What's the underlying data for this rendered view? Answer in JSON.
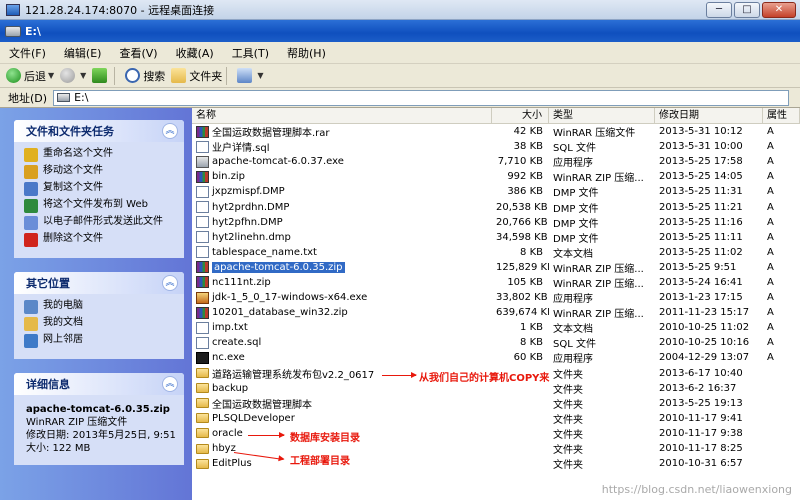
{
  "rdp": {
    "title": "121.28.24.174:8070 - 远程桌面连接",
    "minimize": "─",
    "maximize": "□",
    "close": "✕"
  },
  "explorer": {
    "title": "E:\\"
  },
  "menu": [
    "文件(F)",
    "编辑(E)",
    "查看(V)",
    "收藏(A)",
    "工具(T)",
    "帮助(H)"
  ],
  "toolbar": {
    "back": "后退",
    "search": "搜索",
    "folders": "文件夹"
  },
  "address": {
    "label": "地址(D)",
    "value": "E:\\"
  },
  "tasks_panel": {
    "title": "文件和文件夹任务",
    "items": [
      {
        "label": "重命名这个文件",
        "icon": "rename-icon",
        "color": "#e0b020"
      },
      {
        "label": "移动这个文件",
        "icon": "move-icon",
        "color": "#d9a020"
      },
      {
        "label": "复制这个文件",
        "icon": "copy-icon",
        "color": "#4a78c8"
      },
      {
        "label": "将这个文件发布到 Web",
        "icon": "web-publish-icon",
        "color": "#2e8a3e"
      },
      {
        "label": "以电子邮件形式发送此文件",
        "icon": "email-icon",
        "color": "#6a8ed8"
      },
      {
        "label": "删除这个文件",
        "icon": "delete-icon",
        "color": "#d0241c"
      }
    ]
  },
  "places_panel": {
    "title": "其它位置",
    "items": [
      {
        "label": "我的电脑",
        "icon": "my-computer-icon",
        "color": "#5b88c8"
      },
      {
        "label": "我的文档",
        "icon": "my-documents-icon",
        "color": "#e5b94a"
      },
      {
        "label": "网上邻居",
        "icon": "network-icon",
        "color": "#3e7ac8"
      }
    ]
  },
  "details_panel": {
    "title": "详细信息",
    "filename": "apache-tomcat-6.0.35.zip",
    "type": "WinRAR ZIP 压缩文件",
    "modified": "修改日期: 2013年5月25日, 9:51",
    "size": "大小: 122 MB"
  },
  "columns": {
    "name": "名称",
    "size": "大小",
    "type": "类型",
    "date": "修改日期",
    "attr": "属性"
  },
  "files": [
    {
      "name": "全国运政数据管理脚本.rar",
      "size": "42 KB",
      "type": "WinRAR 压缩文件",
      "date": "2013-5-31 10:12",
      "attr": "A",
      "icon": "archive"
    },
    {
      "name": "业户详情.sql",
      "size": "38 KB",
      "type": "SQL 文件",
      "date": "2013-5-31 10:00",
      "attr": "A",
      "icon": "doc"
    },
    {
      "name": "apache-tomcat-6.0.37.exe",
      "size": "7,710 KB",
      "type": "应用程序",
      "date": "2013-5-25 17:58",
      "attr": "A",
      "icon": "exe"
    },
    {
      "name": "bin.zip",
      "size": "992 KB",
      "type": "WinRAR ZIP 压缩...",
      "date": "2013-5-25 14:05",
      "attr": "A",
      "icon": "archive"
    },
    {
      "name": "jxpzmispf.DMP",
      "size": "386 KB",
      "type": "DMP 文件",
      "date": "2013-5-25 11:31",
      "attr": "A",
      "icon": "doc"
    },
    {
      "name": "hyt2prdhn.DMP",
      "size": "20,538 KB",
      "type": "DMP 文件",
      "date": "2013-5-25 11:21",
      "attr": "A",
      "icon": "doc"
    },
    {
      "name": "hyt2pfhn.DMP",
      "size": "20,766 KB",
      "type": "DMP 文件",
      "date": "2013-5-25 11:16",
      "attr": "A",
      "icon": "doc"
    },
    {
      "name": "hyt2linehn.dmp",
      "size": "34,598 KB",
      "type": "DMP 文件",
      "date": "2013-5-25 11:11",
      "attr": "A",
      "icon": "doc"
    },
    {
      "name": "tablespace_name.txt",
      "size": "8 KB",
      "type": "文本文档",
      "date": "2013-5-25 11:02",
      "attr": "A",
      "icon": "doc"
    },
    {
      "name": "apache-tomcat-6.0.35.zip",
      "size": "125,829 KB",
      "type": "WinRAR ZIP 压缩...",
      "date": "2013-5-25 9:51",
      "attr": "A",
      "icon": "archive",
      "selected": true
    },
    {
      "name": "nc111nt.zip",
      "size": "105 KB",
      "type": "WinRAR ZIP 压缩...",
      "date": "2013-5-24 16:41",
      "attr": "A",
      "icon": "archive"
    },
    {
      "name": "jdk-1_5_0_17-windows-x64.exe",
      "size": "33,802 KB",
      "type": "应用程序",
      "date": "2013-1-23 17:15",
      "attr": "A",
      "icon": "java"
    },
    {
      "name": "10201_database_win32.zip",
      "size": "639,674 KB",
      "type": "WinRAR ZIP 压缩...",
      "date": "2011-11-23 15:17",
      "attr": "A",
      "icon": "archive"
    },
    {
      "name": "imp.txt",
      "size": "1 KB",
      "type": "文本文档",
      "date": "2010-10-25 11:02",
      "attr": "A",
      "icon": "doc"
    },
    {
      "name": "create.sql",
      "size": "8 KB",
      "type": "SQL 文件",
      "date": "2010-10-25 10:16",
      "attr": "A",
      "icon": "doc"
    },
    {
      "name": "nc.exe",
      "size": "60 KB",
      "type": "应用程序",
      "date": "2004-12-29 13:07",
      "attr": "A",
      "icon": "nc"
    },
    {
      "name": "道路运输管理系统发布包v2.2_0617",
      "size": "",
      "type": "文件夹",
      "date": "2013-6-17 10:40",
      "attr": "",
      "icon": "folder"
    },
    {
      "name": "backup",
      "size": "",
      "type": "文件夹",
      "date": "2013-6-2 16:37",
      "attr": "",
      "icon": "folder"
    },
    {
      "name": "全国运政数据管理脚本",
      "size": "",
      "type": "文件夹",
      "date": "2013-5-25 19:13",
      "attr": "",
      "icon": "folder"
    },
    {
      "name": "PLSQLDeveloper",
      "size": "",
      "type": "文件夹",
      "date": "2010-11-17 9:41",
      "attr": "",
      "icon": "folder"
    },
    {
      "name": "oracle",
      "size": "",
      "type": "文件夹",
      "date": "2010-11-17 9:38",
      "attr": "",
      "icon": "folder"
    },
    {
      "name": "hbyz",
      "size": "",
      "type": "文件夹",
      "date": "2010-11-17 8:25",
      "attr": "",
      "icon": "folder"
    },
    {
      "name": "EditPlus",
      "size": "",
      "type": "文件夹",
      "date": "2010-10-31 6:57",
      "attr": "",
      "icon": "folder"
    }
  ],
  "annotations": {
    "copy_note": "从我们自己的计算机COPY来",
    "db_note": "数据库安装目录",
    "deploy_note": "工程部署目录",
    "color": "#e8180c"
  },
  "watermark": "https://blog.csdn.net/liaowenxiong"
}
